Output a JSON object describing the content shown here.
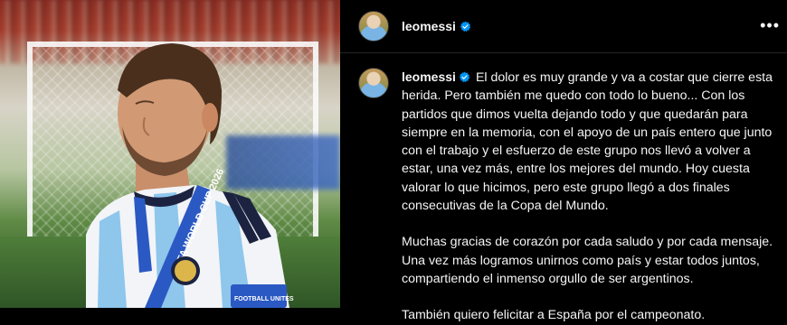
{
  "post": {
    "username": "leomessi",
    "verified": true,
    "more_label": "•••"
  },
  "photo": {
    "alt": "Player wearing Argentina jersey and medal",
    "ribbon_text": "FIFA WORLD CUP 2026",
    "patch_text": "FOOTBALL UNITES"
  },
  "caption": {
    "paragraph1": "El dolor es muy grande y va a costar que cierre esta herida. Pero también me quedo con todo lo bueno... Con los partidos que dimos vuelta dejando todo y que quedarán para siempre en la memoria, con el apoyo de un país entero que junto con el trabajo y el esfuerzo de este grupo nos llevó a volver a estar, una vez más, entre los mejores del mundo. Hoy cuesta valorar lo que hicimos, pero este grupo llegó a dos finales consecutivas de la Copa del Mundo.",
    "paragraph2": "Muchas gracias de corazón por cada saludo y por cada mensaje. Una vez más logramos unirnos como país y estar todos juntos, compartiendo el inmenso orgullo de ser argentinos.",
    "paragraph3": "También quiero felicitar a España por el campeonato."
  },
  "colors": {
    "background": "#000000",
    "text": "#f5f5f5",
    "verified_badge": "#0095f6",
    "divider": "#262626"
  }
}
